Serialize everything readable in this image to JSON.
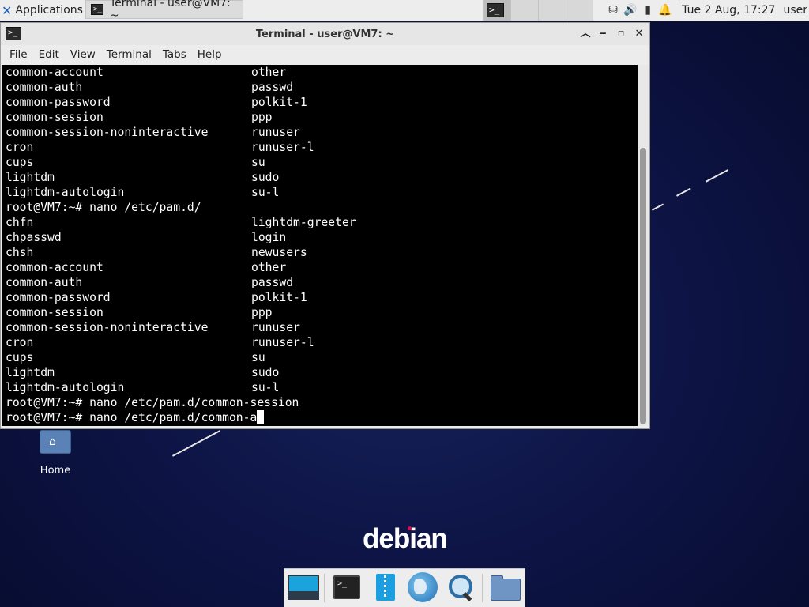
{
  "top_panel": {
    "apps_label": "Applications",
    "task_title": "Terminal - user@VM7: ~",
    "clock": "Tue  2 Aug, 17:27",
    "user": "user"
  },
  "window": {
    "title": "Terminal - user@VM7: ~",
    "menu": [
      "File",
      "Edit",
      "View",
      "Terminal",
      "Tabs",
      "Help"
    ]
  },
  "terminal": {
    "lines": [
      {
        "a": "common-account",
        "b": "other"
      },
      {
        "a": "common-auth",
        "b": "passwd"
      },
      {
        "a": "common-password",
        "b": "polkit-1"
      },
      {
        "a": "common-session",
        "b": "ppp"
      },
      {
        "a": "common-session-noninteractive",
        "b": "runuser"
      },
      {
        "a": "cron",
        "b": "runuser-l"
      },
      {
        "a": "cups",
        "b": "su"
      },
      {
        "a": "lightdm",
        "b": "sudo"
      },
      {
        "a": "lightdm-autologin",
        "b": "su-l"
      },
      {
        "a": "root@VM7:~# nano /etc/pam.d/",
        "b": ""
      },
      {
        "a": "chfn",
        "b": "lightdm-greeter"
      },
      {
        "a": "chpasswd",
        "b": "login"
      },
      {
        "a": "chsh",
        "b": "newusers"
      },
      {
        "a": "common-account",
        "b": "other"
      },
      {
        "a": "common-auth",
        "b": "passwd"
      },
      {
        "a": "common-password",
        "b": "polkit-1"
      },
      {
        "a": "common-session",
        "b": "ppp"
      },
      {
        "a": "common-session-noninteractive",
        "b": "runuser"
      },
      {
        "a": "cron",
        "b": "runuser-l"
      },
      {
        "a": "cups",
        "b": "su"
      },
      {
        "a": "lightdm",
        "b": "sudo"
      },
      {
        "a": "lightdm-autologin",
        "b": "su-l"
      },
      {
        "a": "root@VM7:~# nano /etc/pam.d/common-session",
        "b": ""
      }
    ],
    "prompt_line": "root@VM7:~# nano /etc/pam.d/common-a"
  },
  "desktop": {
    "home_label": "Home",
    "brand": "debian"
  },
  "icons": {
    "apps": "xfce-logo-icon",
    "term": "terminal-icon",
    "network": "network-icon",
    "volume": "volume-icon",
    "battery": "battery-icon",
    "notifications": "bell-icon",
    "home": "home-folder-icon"
  },
  "colors": {
    "desktop_bg": "#0e1547",
    "panel_bg": "#ededed",
    "terminal_bg": "#000000",
    "terminal_fg": "#ffffff",
    "debian_red": "#d70a53"
  }
}
